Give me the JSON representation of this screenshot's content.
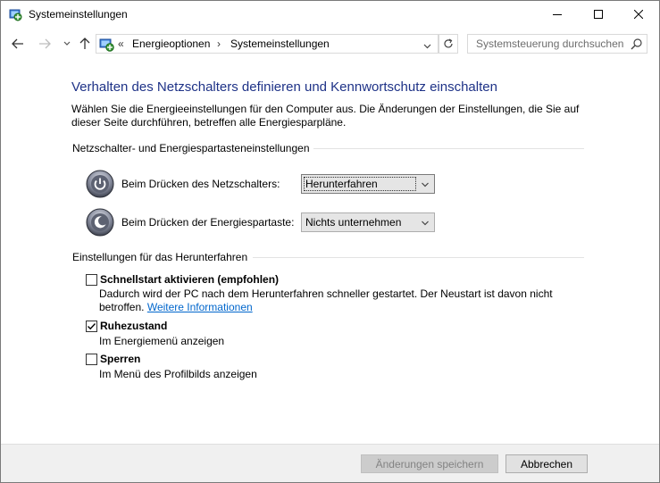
{
  "window": {
    "title": "Systemeinstellungen"
  },
  "navigation": {
    "breadcrumb_prefix": "«",
    "breadcrumb": [
      "Energieoptionen",
      "Systemeinstellungen"
    ],
    "breadcrumb_separator": "›",
    "search_placeholder": "Systemsteuerung durchsuchen"
  },
  "main": {
    "title": "Verhalten des Netzschalters definieren und Kennwortschutz einschalten",
    "intro_line1": "Wählen Sie die Energieeinstellungen für den Computer aus. Die Änderungen der Einstellungen, die Sie auf",
    "intro_line2": "dieser Seite durchführen, betreffen alle Energiesparpläne.",
    "power_section": {
      "header": "Netzschalter- und Energiespartasteneinstellungen",
      "settings": [
        {
          "label": "Beim Drücken des Netzschalters:",
          "value": "Herunterfahren"
        },
        {
          "label": "Beim Drücken der Energiespartaste:",
          "value": "Nichts unternehmen"
        }
      ]
    },
    "shutdown_section": {
      "header": "Einstellungen für das Herunterfahren",
      "options": [
        {
          "title": "Schnellstart aktivieren (empfohlen)",
          "desc_line1": "Dadurch wird der PC nach dem Herunterfahren schneller gestartet. Der Neustart ist davon nicht",
          "desc_line2": "betroffen.",
          "link": "Weitere Informationen",
          "checked": false
        },
        {
          "title": "Ruhezustand",
          "desc_line1": "Im Energiemenü anzeigen",
          "checked": true
        },
        {
          "title": "Sperren",
          "desc_line1": "Im Menü des Profilbilds anzeigen",
          "checked": false
        }
      ]
    }
  },
  "footer": {
    "save_label": "Änderungen speichern",
    "cancel_label": "Abbrechen"
  },
  "colors": {
    "title_blue": "#1e3287",
    "link_blue": "#0066cc",
    "disabled_text": "#838383"
  }
}
